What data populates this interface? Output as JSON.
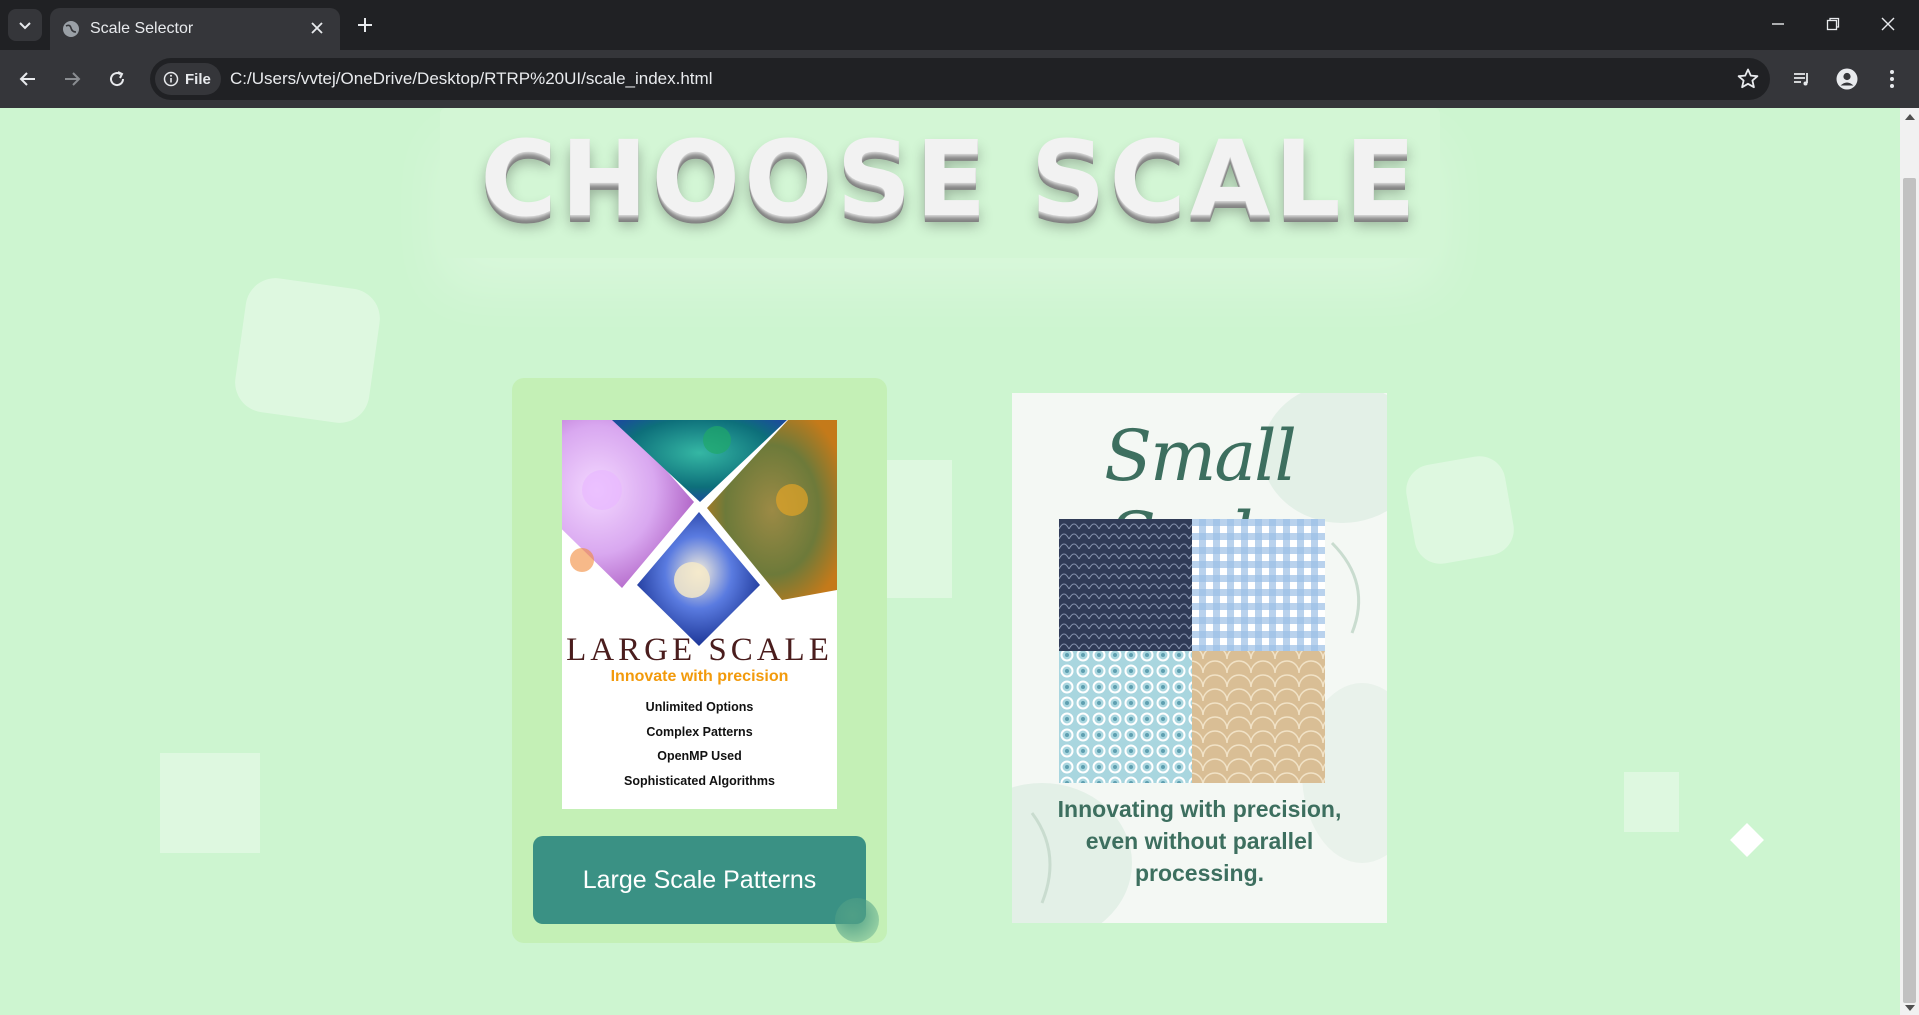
{
  "browser": {
    "tab_title": "Scale Selector",
    "site_chip_label": "File",
    "url": "C:/Users/vvtej/OneDrive/Desktop/RTRP%20UI/scale_index.html"
  },
  "page": {
    "title": "CHOOSE SCALE",
    "large_card": {
      "poster_title": "LARGE SCALE",
      "poster_subtitle": "Innovate with precision",
      "features": [
        "Unlimited Options",
        "Complex Patterns",
        "OpenMP Used",
        "Sophisticated Algorithms"
      ],
      "button_label": "Large Scale Patterns"
    },
    "small_card": {
      "poster_title": "Small Scale",
      "tagline_lines": [
        "Innovating with precision,",
        "even without parallel",
        "processing."
      ]
    }
  },
  "colors": {
    "page_background": "#cdf5d0",
    "card_background": "#c4f0b6",
    "button_background": "#3a9184",
    "large_subtitle": "#f29a0b",
    "small_title": "#3d6f5f"
  }
}
